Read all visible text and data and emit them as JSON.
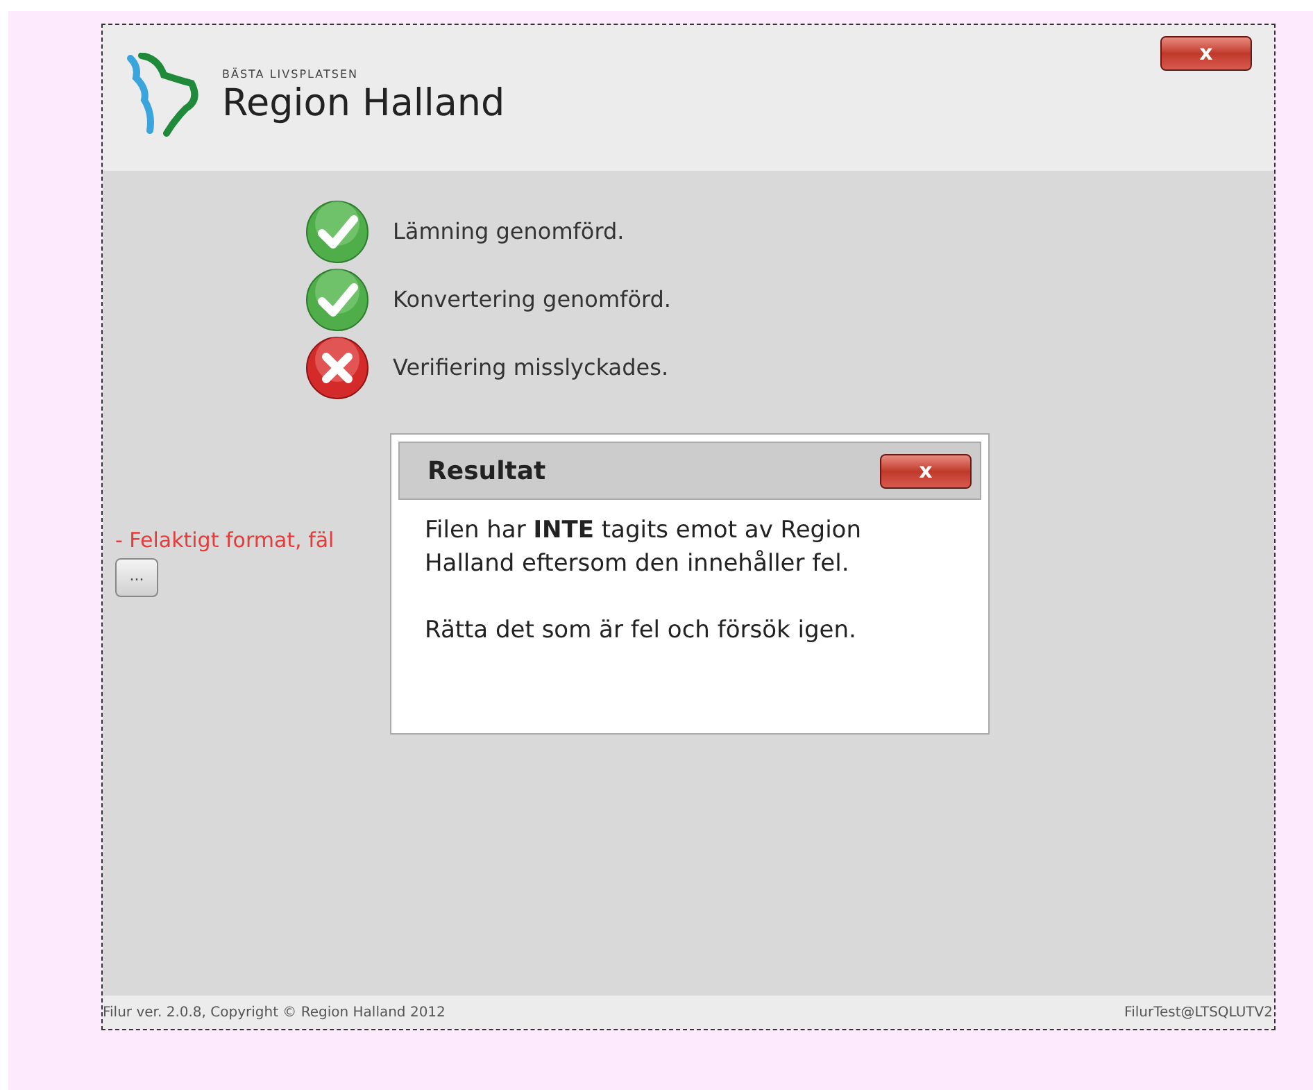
{
  "header": {
    "tagline": "BÄSTA LIVSPLATSEN",
    "org_name": "Region Halland",
    "close_button": "x"
  },
  "steps": [
    {
      "kind": "ok",
      "label": "Lämning genomförd."
    },
    {
      "kind": "ok",
      "label": "Konvertering genomförd."
    },
    {
      "kind": "error",
      "label": "Verifiering misslyckades."
    }
  ],
  "error_message": "- Felaktigt format, fäl",
  "more_button": "...",
  "dialog": {
    "title": "Resultat",
    "close_button": "x",
    "paragraphs": [
      "Filen har **INTE** tagits emot av Region Halland eftersom den innehåller fel.",
      "Rätta det som är fel och försök igen."
    ]
  },
  "footer": {
    "left": "Filur ver. 2.0.8, Copyright © Region Halland 2012",
    "right": "FilurTest@LTSQLUTV2"
  }
}
